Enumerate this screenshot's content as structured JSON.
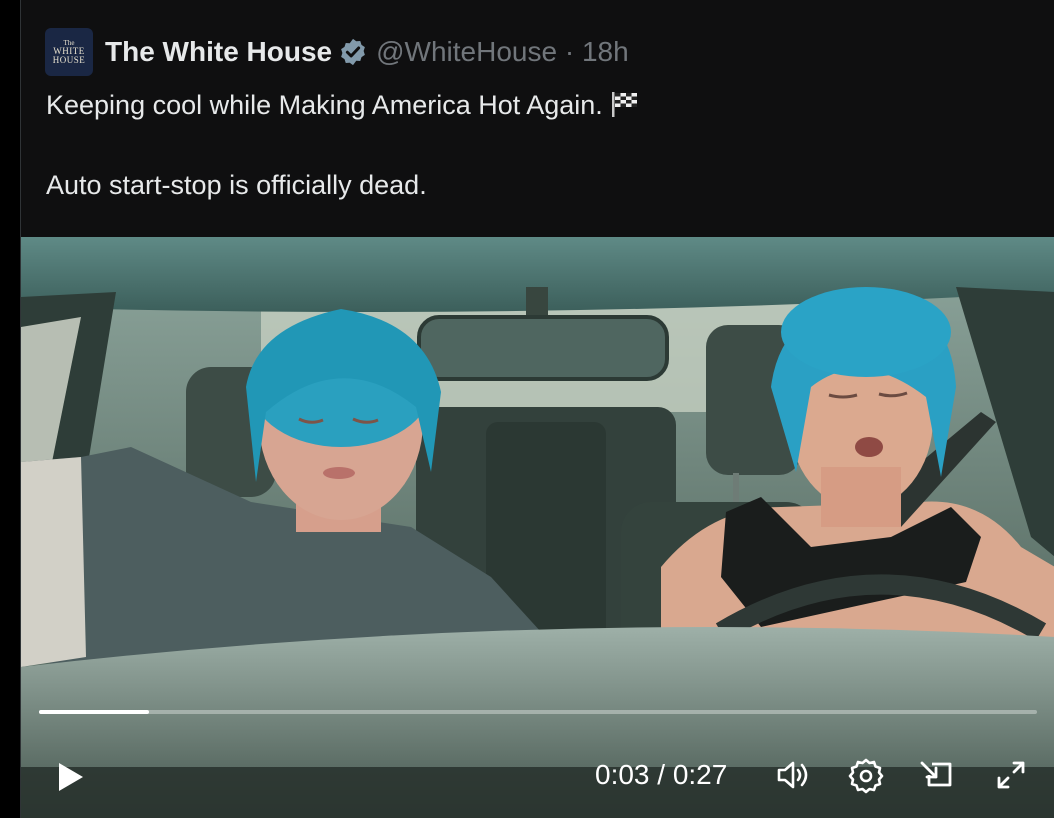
{
  "tweet": {
    "avatar_lines": [
      "The",
      "WHITE",
      "HOUSE"
    ],
    "author_name": "The White House",
    "handle_time": "@WhiteHouse · 18h",
    "text_line1": "Keeping cool while Making America Hot Again.",
    "text_line2": "Auto start-stop is officially dead.",
    "verified_color": "#829aab"
  },
  "video": {
    "current_time": "0:03",
    "duration": "0:27",
    "time_display": "0:03 / 0:27",
    "progress_fraction": 0.11,
    "controls": [
      "play-icon",
      "volume-icon",
      "settings-icon",
      "pip-icon",
      "fullscreen-icon"
    ]
  }
}
